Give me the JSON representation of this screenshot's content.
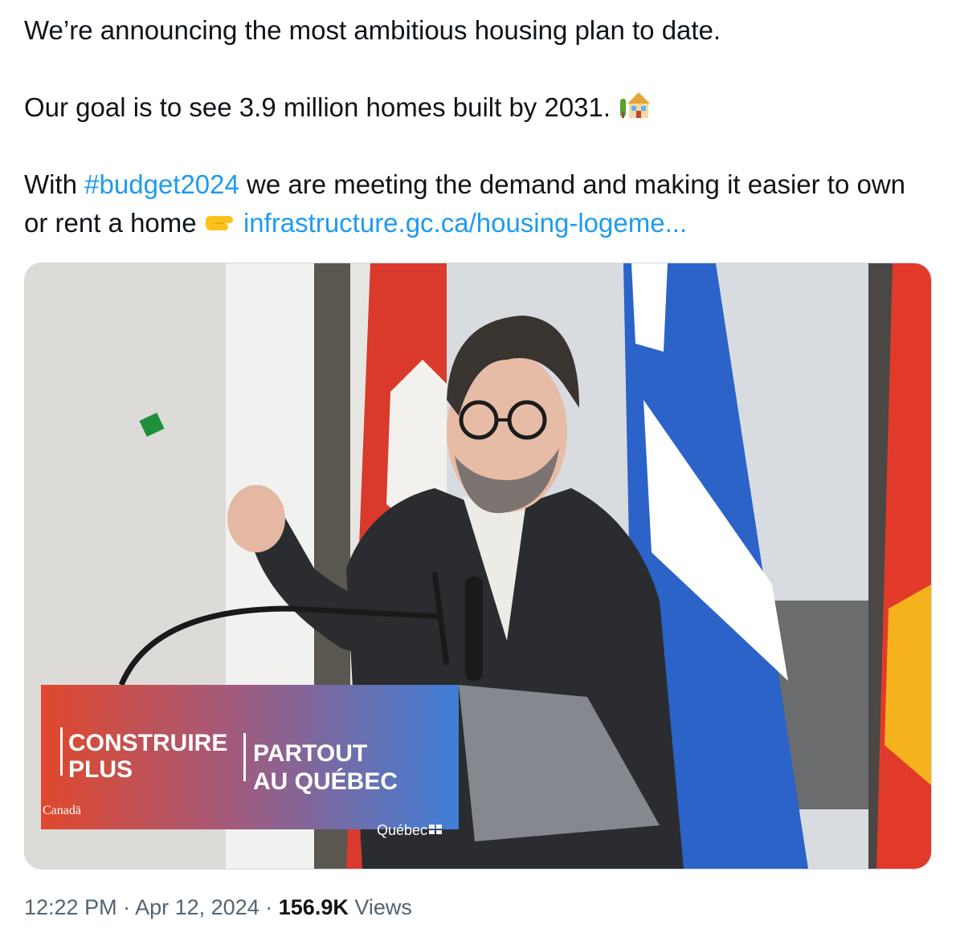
{
  "tweet": {
    "line1": "We’re announcing the most ambitious housing plan to date.",
    "line2_text": "Our goal is to see 3.9 million homes built by 2031.",
    "line2_emoji": "house-with-garden-icon",
    "line3_prefix": "With",
    "hashtag": "#budget2024",
    "line3_middle": "we are meeting the demand and making it easier to own or rent a home",
    "pointing_emoji": "pointing-right-icon",
    "link": "infrastructure.gc.ca/housing-logeme..."
  },
  "media": {
    "podium_left_line1": "CONSTRUIRE",
    "podium_left_line2": "PLUS",
    "podium_right_line1": "PARTOUT",
    "podium_right_line2": "AU QUÉBEC",
    "canada_wordmark": "Canadä",
    "quebec_wordmark": "Québec"
  },
  "meta": {
    "time": "12:22 PM",
    "date": "Apr 12, 2024",
    "views_count": "156.9K",
    "views_label": "Views",
    "separator": "·"
  },
  "colors": {
    "link": "#1d9bf0",
    "text": "#0f1419",
    "muted": "#536471",
    "border": "#cfd9de"
  }
}
